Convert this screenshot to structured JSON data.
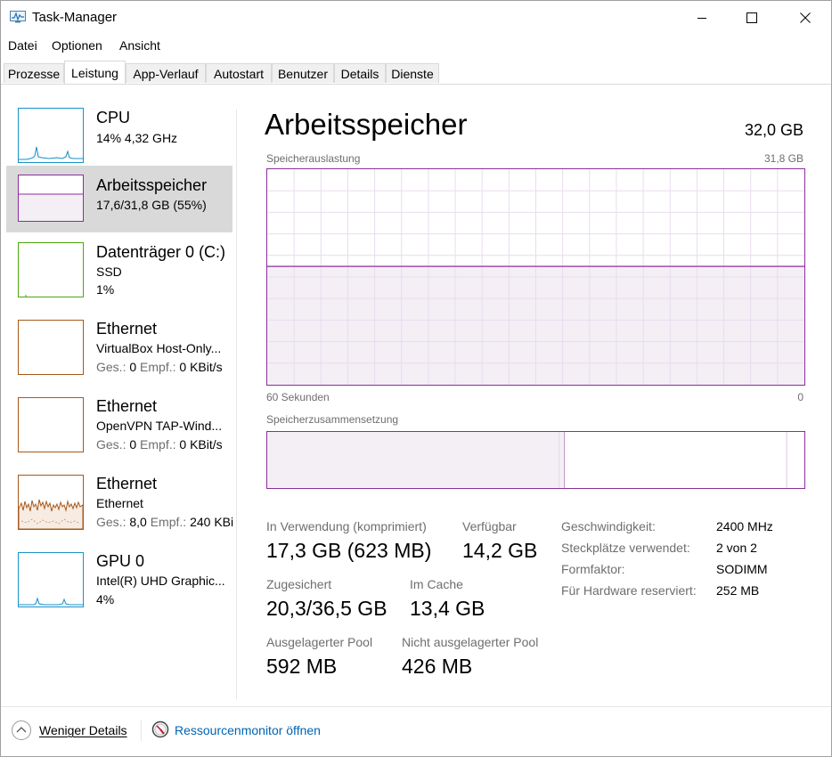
{
  "window": {
    "title": "Task-Manager"
  },
  "menu": {
    "items": [
      "Datei",
      "Optionen",
      "Ansicht"
    ]
  },
  "tabs": [
    "Prozesse",
    "Leistung",
    "App-Verlauf",
    "Autostart",
    "Benutzer",
    "Details",
    "Dienste"
  ],
  "active_tab": "Leistung",
  "sidebar": {
    "items": [
      {
        "title": "CPU",
        "line1": "14%  4,32 GHz",
        "line2": "",
        "color": "#1791c9"
      },
      {
        "title": "Arbeitsspeicher",
        "line1": "17,6/31,8 GB (55%)",
        "line2": "",
        "color": "#8b2e9b"
      },
      {
        "title": "Datenträger 0 (C:)",
        "line1": "SSD",
        "line2": "1%",
        "color": "#4da60c"
      },
      {
        "title": "Ethernet",
        "line1": "VirtualBox Host-Only...",
        "line2_label1": "Ges.:",
        "line2_value1": "0",
        "line2_label2": "Empf.:",
        "line2_value2": "0 KBit/s",
        "color": "#a7581a"
      },
      {
        "title": "Ethernet",
        "line1": "OpenVPN TAP-Wind...",
        "line2_label1": "Ges.:",
        "line2_value1": "0",
        "line2_label2": "Empf.:",
        "line2_value2": "0 KBit/s",
        "color": "#a7581a"
      },
      {
        "title": "Ethernet",
        "line1": "Ethernet",
        "line2_label1": "Ges.:",
        "line2_value1": "8,0",
        "line2_label2": "Empf.:",
        "line2_value2": "240 KBi",
        "color": "#a7581a"
      },
      {
        "title": "GPU 0",
        "line1": "Intel(R) UHD Graphic...",
        "line2": "4%",
        "color": "#1791c9"
      }
    ]
  },
  "main": {
    "title": "Arbeitsspeicher",
    "total": "32,0 GB",
    "graph_label": "Speicherauslastung",
    "graph_max": "31,8 GB",
    "graph_left": "60 Sekunden",
    "graph_right": "0",
    "usage_fraction": 0.55,
    "composition_label": "Speicherzusammensetzung",
    "composition": {
      "in_use_fraction": 0.544,
      "modified_fraction": 0.01,
      "standby_fraction": 0.413
    },
    "stats": {
      "in_use_label": "In Verwendung (komprimiert)",
      "in_use_value": "17,3 GB (623 MB)",
      "available_label": "Verfügbar",
      "available_value": "14,2 GB",
      "committed_label": "Zugesichert",
      "committed_value": "20,3/36,5 GB",
      "cached_label": "Im Cache",
      "cached_value": "13,4 GB",
      "paged_label": "Ausgelagerter Pool",
      "paged_value": "592 MB",
      "nonpaged_label": "Nicht ausgelagerter Pool",
      "nonpaged_value": "426 MB"
    },
    "properties": [
      {
        "label": "Geschwindigkeit:",
        "value": "2400 MHz"
      },
      {
        "label": "Steckplätze verwendet:",
        "value": "2 von 2"
      },
      {
        "label": "Formfaktor:",
        "value": "SODIMM"
      },
      {
        "label": "Für Hardware reserviert:",
        "value": "252 MB"
      }
    ]
  },
  "footer": {
    "fewer_details": "Weniger Details",
    "resource_monitor": "Ressourcenmonitor öffnen",
    "link_color": "#0063b1"
  },
  "colors": {
    "memory": "#8b2e9b",
    "memory_fill": "#f3eff5",
    "grid": "#e9dcee"
  }
}
